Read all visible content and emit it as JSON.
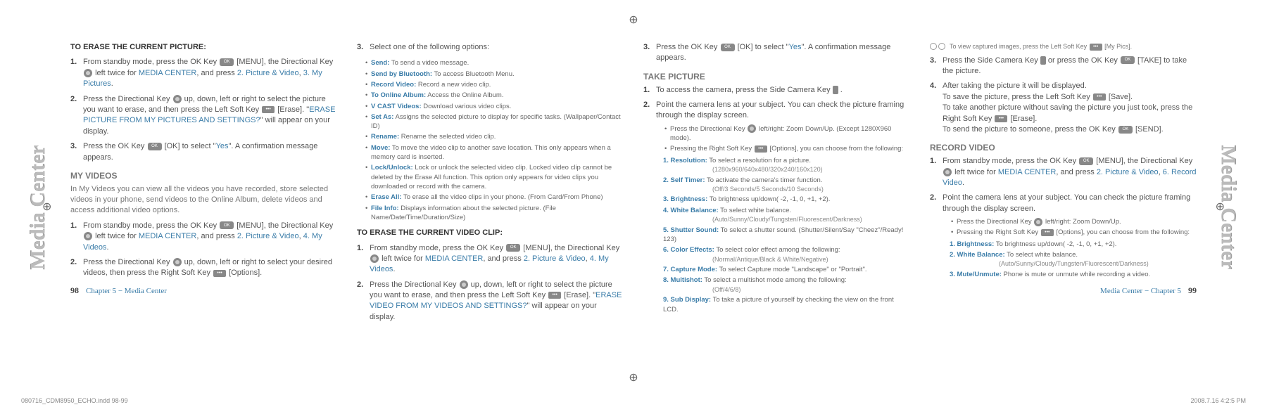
{
  "side_tab": "Media Center",
  "reg_glyph": "⊕",
  "col1": {
    "erase_title": "TO ERASE THE CURRENT PICTURE:",
    "step1_a": "From standby mode, press the OK Key",
    "step1_b": "[MENU], the Directional Key",
    "step1_c": "left twice for",
    "step1_media": "MEDIA CENTER",
    "step1_d": ", and press",
    "step1_pic": "2. Picture & Video",
    "step1_e": ",",
    "step1_mypics": "3. My Pictures",
    "step2_a": "Press the Directional Key",
    "step2_b": "up, down, left or right to select the picture you want to erase, and then press the Left Soft Key",
    "step2_c": "[Erase]. \"",
    "step2_msg": "ERASE PICTURE FROM MY PICTURES AND SETTINGS?",
    "step2_d": "\" will appear on your display.",
    "step3_a": "Press the OK Key",
    "step3_b": "[OK] to select \"",
    "step3_yes": "Yes",
    "step3_c": "\". A confirmation message appears.",
    "myvideos_title": "MY VIDEOS",
    "myvideos_intro": "In My Videos you can view all the videos you have recorded, store selected videos in your phone, send videos to the Online Album, delete videos and access additional video options.",
    "mv1_a": "From standby mode, press the OK Key",
    "mv1_b": "[MENU], the Directional Key",
    "mv1_c": "left twice for",
    "mv1_media": "MEDIA CENTER",
    "mv1_d": ", and press",
    "mv1_pic": "2. Picture & Video",
    "mv1_e": ",",
    "mv1_myvideos": "4. My Videos",
    "mv2_a": "Press the Directional Key",
    "mv2_b": "up, down, left or right to select your desired videos, then press the Right Soft Key",
    "mv2_c": "[Options].",
    "page_left_num": "98",
    "page_left_label": "Chapter 5 − Media Center"
  },
  "col2": {
    "step3_a": "Select one of the following options:",
    "opts": {
      "send": "Send:",
      "send_t": "To send a video message.",
      "sendbt": "Send by Bluetooth:",
      "sendbt_t": "To access Bluetooth Menu.",
      "rec": "Record Video:",
      "rec_t": "Record a new video clip.",
      "online": "To Online Album:",
      "online_t": "Access the Online Album.",
      "vcast": "V CAST Videos:",
      "vcast_t": "Download various video clips.",
      "setas": "Set As:",
      "setas_t": "Assigns the selected picture to display for specific tasks. (Wallpaper/Contact ID)",
      "rename": "Rename:",
      "rename_t": "Rename the selected video clip.",
      "move": "Move:",
      "move_t": "To move the video clip to another save location. This only appears when a memory card is inserted.",
      "lock": "Lock/Unlock:",
      "lock_t": "Lock or unlock the selected video clip. Locked video clip cannot be deleted by the Erase All function. This option only appears for video clips you downloaded or record with the camera.",
      "eraseall": "Erase All:",
      "eraseall_t": "To erase all the video clips in your phone. (From Card/From Phone)",
      "fileinfo": "File Info:",
      "fileinfo_t": "Displays information about the selected picture. (File Name/Date/Time/Duration/Size)"
    },
    "evc_title": "TO ERASE THE CURRENT VIDEO CLIP:",
    "evc1_a": "From standby mode, press the OK Key",
    "evc1_b": "[MENU], the Directional Key",
    "evc1_c": "left twice for",
    "evc1_media": "MEDIA CENTER",
    "evc1_d": ", and press",
    "evc1_pic": "2. Picture & Video",
    "evc1_e": ",",
    "evc1_mv": "4. My Videos",
    "evc2_a": "Press the Directional Key",
    "evc2_b": "up, down, left or right to select the picture you want to erase, and then press the Left Soft Key",
    "evc2_c": "[Erase]. \"",
    "evc2_msg": "ERASE VIDEO FROM MY VIDEOS AND SETTINGS?",
    "evc2_d": "\" will appear on your display."
  },
  "col3": {
    "step3_a": "Press the OK Key",
    "step3_b": "[OK] to select \"",
    "step3_yes": "Yes",
    "step3_c": "\". A confirmation message appears.",
    "take_title": "TAKE PICTURE",
    "tp1_a": "To access the camera, press the Side Camera Key",
    "tp1_b": ".",
    "tp2_a": "Point the camera lens at your subject. You can check the picture framing through the display screen.",
    "sub1_a": "Press the Directional Key",
    "sub1_b": "left/right: Zoom Down/Up. (Except 1280X960 mode).",
    "sub2_a": "Pressing the Right Soft Key",
    "sub2_b": "[Options], you can choose from the following:",
    "opts": {
      "res": "1. Resolution:",
      "res_t": "To select a resolution for a picture.",
      "res_d": "(1280x960/640x480/320x240/160x120)",
      "self": "2. Self Timer:",
      "self_t": "To activate the camera's timer function.",
      "self_d": "(Off/3 Seconds/5 Seconds/10 Seconds)",
      "bright": "3. Brightness:",
      "bright_t": "To brightness up/down( -2, -1, 0, +1, +2).",
      "wb": "4. White Balance:",
      "wb_t": "To select white balance.",
      "wb_d": "(Auto/Sunny/Cloudy/Tungsten/Fluorescent/Darkness)",
      "shutter": "5. Shutter Sound:",
      "shutter_t": "To select a shutter sound. (Shutter/Silent/Say \"Cheez\"/Ready! 123)",
      "color": "6. Color Effects:",
      "color_t": "To select color effect among the following:",
      "color_d": "(Normal/Antique/Black & White/Negative)",
      "capture": "7. Capture Mode:",
      "capture_t": "To select Capture mode \"Landscape\" or \"Portrait\".",
      "multi": "8. Multishot:",
      "multi_t": "To select a multishot mode among the following:",
      "multi_d": "(Off/4/6/8)",
      "subd": "9. Sub Display:",
      "subd_t": "To take a picture of yourself by checking the view on the front LCD."
    }
  },
  "col4": {
    "note": "To view captured images, press the Left Soft Key",
    "note_b": "[My Pics].",
    "s3_a": "Press the Side Camera Key",
    "s3_b": "or press the OK Key",
    "s3_c": "[TAKE] to take the picture.",
    "s4_a": "After taking the picture it will be displayed.",
    "s4_b": "To save the picture, press the Left Soft Key",
    "s4_c": "[Save].",
    "s4_d": "To take another picture without saving the picture you just took, press the Right Soft Key",
    "s4_e": "[Erase].",
    "s4_f": "To send the picture to someone, press the OK Key",
    "s4_g": "[SEND].",
    "rv_title": "RECORD VIDEO",
    "rv1_a": "From standby mode, press the OK Key",
    "rv1_b": "[MENU], the Directional Key",
    "rv1_c": "left twice for",
    "rv1_media": "MEDIA CENTER",
    "rv1_d": ", and press",
    "rv1_pic": "2. Picture & Video",
    "rv1_e": ",",
    "rv1_rec": "6. Record Video",
    "rv2_a": "Point the camera lens at your subject. You can check the picture framing through the display screen.",
    "rvsub1_a": "Press the Directional Key",
    "rvsub1_b": "left/right: Zoom Down/Up.",
    "rvsub2_a": "Pressing the Right Soft Key",
    "rvsub2_b": "[Options], you can choose from the following:",
    "ropts": {
      "bright": "1. Brightness:",
      "bright_t": "To brightness up/down( -2, -1, 0, +1, +2).",
      "wb": "2. White Balance:",
      "wb_t": "To select white balance.",
      "wb_d": "(Auto/Sunny/Cloudy/Tungsten/Fluorescent/Darkness)",
      "mute": "3. Mute/Unmute:",
      "mute_t": "Phone is mute or unmute while recording a video."
    },
    "page_right_label": "Media Center − Chapter 5",
    "page_right_num": "99"
  },
  "footer": {
    "left": "080716_CDM8950_ECHO.indd   98-99",
    "right": "2008.7.16   4:2:5 PM"
  }
}
